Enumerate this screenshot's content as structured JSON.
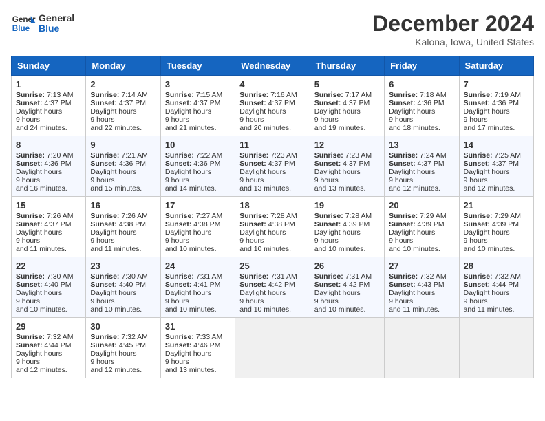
{
  "header": {
    "logo_general": "General",
    "logo_blue": "Blue",
    "month": "December 2024",
    "location": "Kalona, Iowa, United States"
  },
  "days_of_week": [
    "Sunday",
    "Monday",
    "Tuesday",
    "Wednesday",
    "Thursday",
    "Friday",
    "Saturday"
  ],
  "weeks": [
    [
      {
        "day": 1,
        "sunrise": "7:13 AM",
        "sunset": "4:37 PM",
        "daylight": "9 hours and 24 minutes."
      },
      {
        "day": 2,
        "sunrise": "7:14 AM",
        "sunset": "4:37 PM",
        "daylight": "9 hours and 22 minutes."
      },
      {
        "day": 3,
        "sunrise": "7:15 AM",
        "sunset": "4:37 PM",
        "daylight": "9 hours and 21 minutes."
      },
      {
        "day": 4,
        "sunrise": "7:16 AM",
        "sunset": "4:37 PM",
        "daylight": "9 hours and 20 minutes."
      },
      {
        "day": 5,
        "sunrise": "7:17 AM",
        "sunset": "4:37 PM",
        "daylight": "9 hours and 19 minutes."
      },
      {
        "day": 6,
        "sunrise": "7:18 AM",
        "sunset": "4:36 PM",
        "daylight": "9 hours and 18 minutes."
      },
      {
        "day": 7,
        "sunrise": "7:19 AM",
        "sunset": "4:36 PM",
        "daylight": "9 hours and 17 minutes."
      }
    ],
    [
      {
        "day": 8,
        "sunrise": "7:20 AM",
        "sunset": "4:36 PM",
        "daylight": "9 hours and 16 minutes."
      },
      {
        "day": 9,
        "sunrise": "7:21 AM",
        "sunset": "4:36 PM",
        "daylight": "9 hours and 15 minutes."
      },
      {
        "day": 10,
        "sunrise": "7:22 AM",
        "sunset": "4:36 PM",
        "daylight": "9 hours and 14 minutes."
      },
      {
        "day": 11,
        "sunrise": "7:23 AM",
        "sunset": "4:37 PM",
        "daylight": "9 hours and 13 minutes."
      },
      {
        "day": 12,
        "sunrise": "7:23 AM",
        "sunset": "4:37 PM",
        "daylight": "9 hours and 13 minutes."
      },
      {
        "day": 13,
        "sunrise": "7:24 AM",
        "sunset": "4:37 PM",
        "daylight": "9 hours and 12 minutes."
      },
      {
        "day": 14,
        "sunrise": "7:25 AM",
        "sunset": "4:37 PM",
        "daylight": "9 hours and 12 minutes."
      }
    ],
    [
      {
        "day": 15,
        "sunrise": "7:26 AM",
        "sunset": "4:37 PM",
        "daylight": "9 hours and 11 minutes."
      },
      {
        "day": 16,
        "sunrise": "7:26 AM",
        "sunset": "4:38 PM",
        "daylight": "9 hours and 11 minutes."
      },
      {
        "day": 17,
        "sunrise": "7:27 AM",
        "sunset": "4:38 PM",
        "daylight": "9 hours and 10 minutes."
      },
      {
        "day": 18,
        "sunrise": "7:28 AM",
        "sunset": "4:38 PM",
        "daylight": "9 hours and 10 minutes."
      },
      {
        "day": 19,
        "sunrise": "7:28 AM",
        "sunset": "4:39 PM",
        "daylight": "9 hours and 10 minutes."
      },
      {
        "day": 20,
        "sunrise": "7:29 AM",
        "sunset": "4:39 PM",
        "daylight": "9 hours and 10 minutes."
      },
      {
        "day": 21,
        "sunrise": "7:29 AM",
        "sunset": "4:39 PM",
        "daylight": "9 hours and 10 minutes."
      }
    ],
    [
      {
        "day": 22,
        "sunrise": "7:30 AM",
        "sunset": "4:40 PM",
        "daylight": "9 hours and 10 minutes."
      },
      {
        "day": 23,
        "sunrise": "7:30 AM",
        "sunset": "4:40 PM",
        "daylight": "9 hours and 10 minutes."
      },
      {
        "day": 24,
        "sunrise": "7:31 AM",
        "sunset": "4:41 PM",
        "daylight": "9 hours and 10 minutes."
      },
      {
        "day": 25,
        "sunrise": "7:31 AM",
        "sunset": "4:42 PM",
        "daylight": "9 hours and 10 minutes."
      },
      {
        "day": 26,
        "sunrise": "7:31 AM",
        "sunset": "4:42 PM",
        "daylight": "9 hours and 10 minutes."
      },
      {
        "day": 27,
        "sunrise": "7:32 AM",
        "sunset": "4:43 PM",
        "daylight": "9 hours and 11 minutes."
      },
      {
        "day": 28,
        "sunrise": "7:32 AM",
        "sunset": "4:44 PM",
        "daylight": "9 hours and 11 minutes."
      }
    ],
    [
      {
        "day": 29,
        "sunrise": "7:32 AM",
        "sunset": "4:44 PM",
        "daylight": "9 hours and 12 minutes."
      },
      {
        "day": 30,
        "sunrise": "7:32 AM",
        "sunset": "4:45 PM",
        "daylight": "9 hours and 12 minutes."
      },
      {
        "day": 31,
        "sunrise": "7:33 AM",
        "sunset": "4:46 PM",
        "daylight": "9 hours and 13 minutes."
      },
      null,
      null,
      null,
      null
    ]
  ],
  "labels": {
    "sunrise": "Sunrise:",
    "sunset": "Sunset:",
    "daylight": "Daylight hours"
  }
}
